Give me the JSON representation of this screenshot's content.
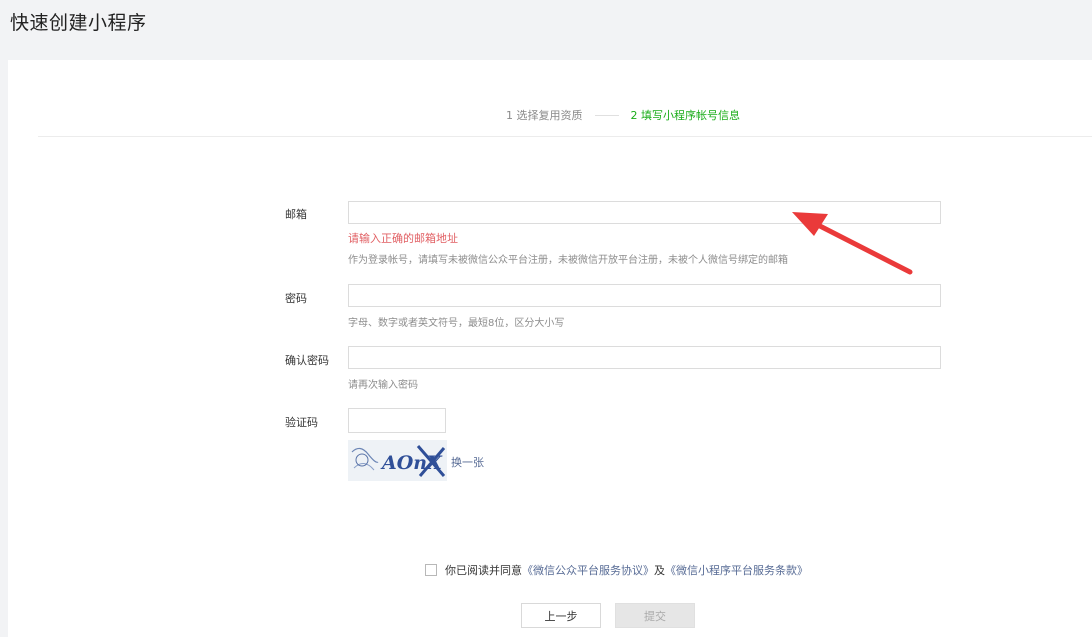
{
  "page": {
    "title": "快速创建小程序"
  },
  "steps": [
    {
      "label": "1 选择复用资质",
      "active": false
    },
    {
      "label": "2 填写小程序帐号信息",
      "active": true
    }
  ],
  "form": {
    "email": {
      "label": "邮箱",
      "value": "",
      "error": "请输入正确的邮箱地址",
      "hint": "作为登录帐号，请填写未被微信公众平台注册，未被微信开放平台注册，未被个人微信号绑定的邮箱"
    },
    "password": {
      "label": "密码",
      "value": "",
      "hint": "字母、数字或者英文符号，最短8位，区分大小写"
    },
    "confirm_password": {
      "label": "确认密码",
      "value": "",
      "hint": "请再次输入密码"
    },
    "captcha": {
      "label": "验证码",
      "value": "",
      "image_text": "AOnX",
      "refresh_label": "换一张"
    }
  },
  "agreement": {
    "checked": false,
    "prefix": "你已阅读并同意",
    "link1": "《微信公众平台服务协议》",
    "connector": "及",
    "link2": "《微信小程序平台服务条款》"
  },
  "buttons": {
    "prev_label": "上一步",
    "submit_label": "提交"
  },
  "colors": {
    "accent_green": "#1aad19",
    "error_red": "#e15f63",
    "link_blue": "#576b95",
    "annotation_arrow": "#ea3a3a"
  },
  "annotation": {
    "icon": "red-arrow-icon"
  }
}
